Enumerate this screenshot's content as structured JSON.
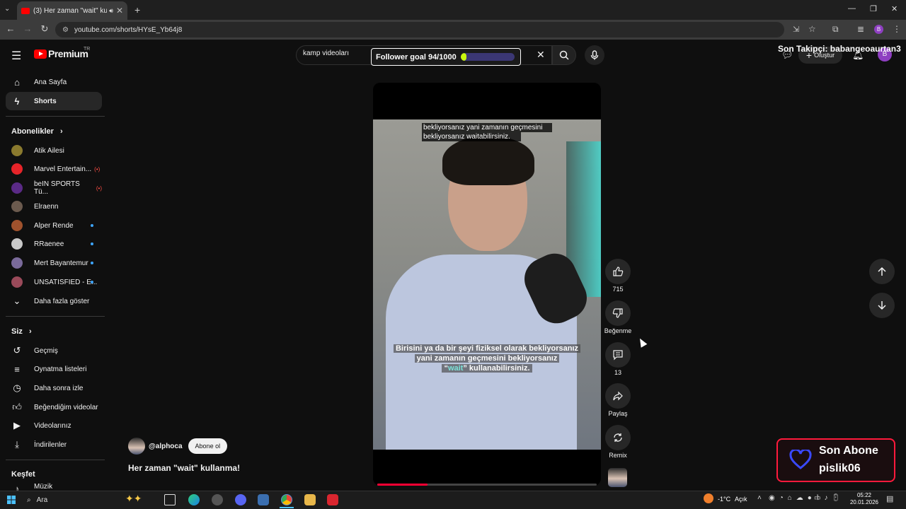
{
  "browser": {
    "tab_title": "(3) Her zaman \"wait\" kullan",
    "url": "youtube.com/shorts/HYsE_Yb64j8"
  },
  "youtube": {
    "logo_text": "Premium",
    "region": "TR",
    "search_query": "kamp videoları",
    "create_label": "Oluştur",
    "sidebar": {
      "home": "Ana Sayfa",
      "shorts": "Shorts",
      "subscriptions_header": "Abonelikler",
      "subscriptions": [
        {
          "name": "Atik Ailesi",
          "live": false,
          "new": false,
          "color": "#8a7a2e"
        },
        {
          "name": "Marvel Entertain...",
          "live": true,
          "new": false,
          "color": "#e62429"
        },
        {
          "name": "beIN SPORTS Tü...",
          "live": true,
          "new": false,
          "color": "#5a2a86"
        },
        {
          "name": "Elraenn",
          "live": false,
          "new": false,
          "color": "#6b5a4e"
        },
        {
          "name": "Alper Rende",
          "live": false,
          "new": true,
          "color": "#a0522d"
        },
        {
          "name": "RRaenee",
          "live": false,
          "new": true,
          "color": "#c8c8c8"
        },
        {
          "name": "Mert Bayantemur",
          "live": false,
          "new": true,
          "color": "#7a6a9a"
        },
        {
          "name": "UNSATISFIED - E...",
          "live": false,
          "new": true,
          "color": "#9a4a5a"
        }
      ],
      "show_more": "Daha fazla göster",
      "you_header": "Siz",
      "you_items": [
        "Geçmiş",
        "Oynatma listeleri",
        "Daha sonra izle",
        "Beğendiğim videolar",
        "Videolarınız",
        "İndirilenler"
      ],
      "explore_header": "Keşfet",
      "explore_partial": "Müzik"
    },
    "short": {
      "caption_top_1": "bekliyorsanız yani zamanın geçmesini",
      "caption_top_2": "bekliyorsanız waitabilirsiniz.",
      "caption_bottom_1": "Birisini ya da bir şeyi fiziksel olarak bekliyorsanız",
      "caption_bottom_2": "yani zamanın geçmesini bekliyorsanız",
      "caption_bottom_3a": "“",
      "caption_bottom_3b": "wait",
      "caption_bottom_3c": "” kullanabilirsiniz.",
      "channel": "@alphoca",
      "subscribe": "Abone ol",
      "title": "Her zaman \"wait\" kullanma!",
      "progress_percent": 23,
      "actions": {
        "like_count": "715",
        "dislike_label": "Beğenme",
        "comment_count": "13",
        "share_label": "Paylaş",
        "remix_label": "Remix"
      }
    }
  },
  "stream_overlays": {
    "follower_goal": "Follower goal 94/1000",
    "follower_current": 94,
    "follower_target": 1000,
    "last_follower": "Son Takipçi: babangeoaurtan3",
    "last_sub_label": "Son Abone",
    "last_sub_name": "pislik06"
  },
  "taskbar": {
    "search": "Ara",
    "weather": "-1°C",
    "weather_desc": "Açık",
    "time": "05:22",
    "date": "20.01.2026"
  }
}
